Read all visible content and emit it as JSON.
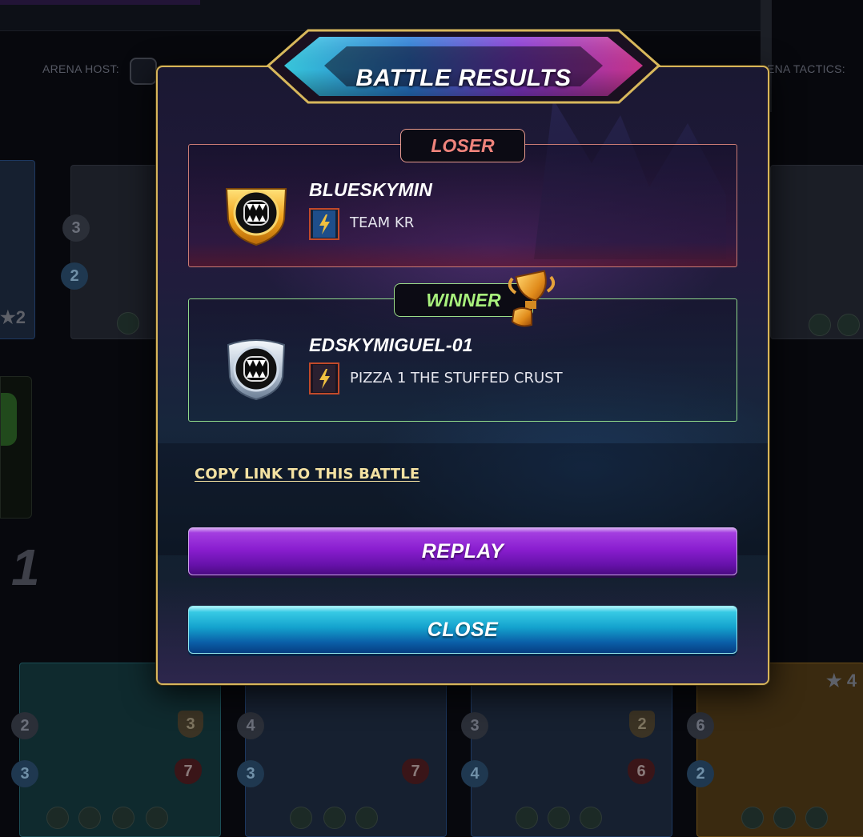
{
  "background": {
    "arena_host_label": "ARENA HOST:",
    "arena_tactics_label": "ENA TACTICS:",
    "big_turn_number": "1",
    "left_star_value": "★2",
    "right_star_value": "★ 4",
    "bottom_cards": [
      {
        "attack": "2",
        "speed": "3",
        "armor": "3",
        "health": "7"
      },
      {
        "attack": "4",
        "speed": "3",
        "armor": "",
        "health": "7"
      },
      {
        "attack": "3",
        "speed": "4",
        "armor": "2",
        "health": "6"
      },
      {
        "attack": "6",
        "speed": "2",
        "armor": "",
        "health": ""
      }
    ],
    "left_card_stats": {
      "attack": "3",
      "speed": "2"
    }
  },
  "modal": {
    "title": "BATTLE RESULTS",
    "loser": {
      "label": "LOSER",
      "player_name": "BLUESKYMIN",
      "guild_name": "TEAM KR",
      "badge_icon": "gold-league-fangs-badge-icon"
    },
    "winner": {
      "label": "WINNER",
      "player_name": "EDSKYMIGUEL-01",
      "guild_name": "PIZZA 1 THE STUFFED CRUST",
      "badge_icon": "silver-league-fangs-badge-icon",
      "trophy_icon": "trophy-icon"
    },
    "copy_link_label": "COPY LINK TO THIS BATTLE",
    "replay_label": "REPLAY",
    "close_label": "CLOSE"
  },
  "colors": {
    "modal_border": "#d7b55a",
    "loser_accent": "#f0847c",
    "winner_accent": "#a8f07c",
    "replay_button": "#8a1ed0",
    "close_button": "#14a2cd",
    "link": "#f4e2a2"
  }
}
